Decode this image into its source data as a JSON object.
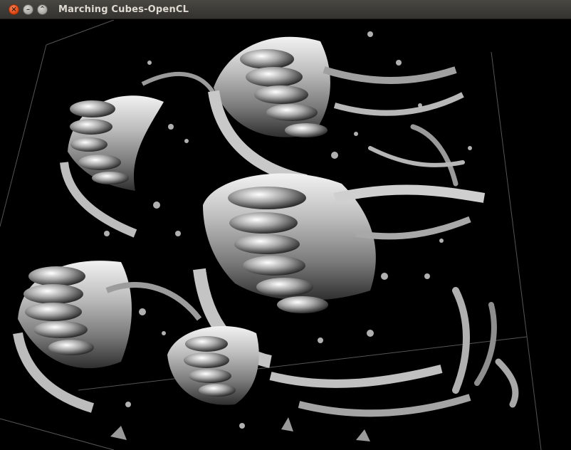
{
  "window": {
    "title": "Marching Cubes-OpenCL",
    "controls": [
      {
        "name": "close",
        "glyph": "×",
        "color": "#df4a16"
      },
      {
        "name": "minimize",
        "glyph": "–",
        "color": "#a9a8a2"
      },
      {
        "name": "maximize",
        "glyph": "⌃",
        "color": "#a9a8a2"
      }
    ]
  },
  "viewport": {
    "background": "#000000",
    "surface_color": "#c0c0c0",
    "icon": "isosurface-render"
  }
}
